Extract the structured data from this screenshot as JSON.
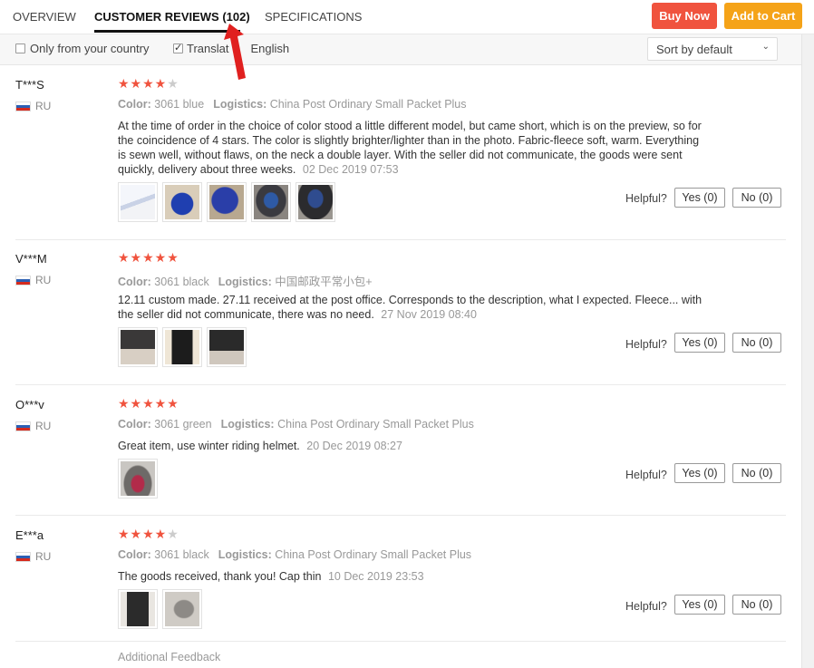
{
  "tabs": [
    "OVERVIEW",
    "CUSTOMER REVIEWS (102)",
    "SPECIFICATIONS"
  ],
  "buttons": {
    "buy_now": "Buy Now",
    "add_to_cart": "Add to Cart"
  },
  "filters": {
    "only_country": "Only from your country",
    "translate": "Translate to English",
    "translate_left": "Translat",
    "translate_right": "English",
    "sort": "Sort by default"
  },
  "reviews": [
    {
      "name": "T***S",
      "country": "RU",
      "stars": 4,
      "color_label": "Color:",
      "color": "3061 blue",
      "logistics_label": "Logistics:",
      "logistics": "China Post Ordinary Small Packet Plus",
      "text": "At the time of order in the choice of color stood a little different model, but came short, which is on the preview, so for the coincidence of 4 stars. The color is slightly brighter/lighter than in the photo. Fabric-fleece soft, warm. Everything is sewn well, without flaws, on the neck a double layer. With the seller did not communicate, the goods were sent quickly, delivery about three weeks.",
      "date": "02 Dec 2019 07:53",
      "helpful": "Helpful?",
      "yes": "Yes (0)",
      "no": "No (0)"
    },
    {
      "name": "V***M",
      "country": "RU",
      "stars": 5,
      "color_label": "Color:",
      "color": "3061 black",
      "logistics_label": "Logistics:",
      "logistics": "中国邮政平常小包+",
      "text": "12.11 custom made. 27.11 received at the post office. Corresponds to the description, what I expected. Fleece... with the seller did not communicate, there was no need.",
      "date": "27 Nov 2019 08:40",
      "helpful": "Helpful?",
      "yes": "Yes (0)",
      "no": "No (0)"
    },
    {
      "name": "O***v",
      "country": "RU",
      "stars": 5,
      "color_label": "Color:",
      "color": "3061 green",
      "logistics_label": "Logistics:",
      "logistics": "China Post Ordinary Small Packet Plus",
      "text": "Great item, use winter riding helmet.",
      "date": "20 Dec 2019 08:27",
      "helpful": "Helpful?",
      "yes": "Yes (0)",
      "no": "No (0)"
    },
    {
      "name": "E***a",
      "country": "RU",
      "stars": 4,
      "color_label": "Color:",
      "color": "3061 black",
      "logistics_label": "Logistics:",
      "logistics": "China Post Ordinary Small Packet Plus",
      "text": "The goods received, thank you! Cap thin",
      "date": "10 Dec 2019 23:53",
      "helpful": "Helpful?",
      "yes": "Yes (0)",
      "no": "No (0)"
    }
  ],
  "additional_feedback": "Additional Feedback",
  "colors": {
    "buy_now": "#f0533e",
    "add_to_cart": "#f5a318",
    "star": "#f0533e",
    "arrow": "#e0201f"
  }
}
